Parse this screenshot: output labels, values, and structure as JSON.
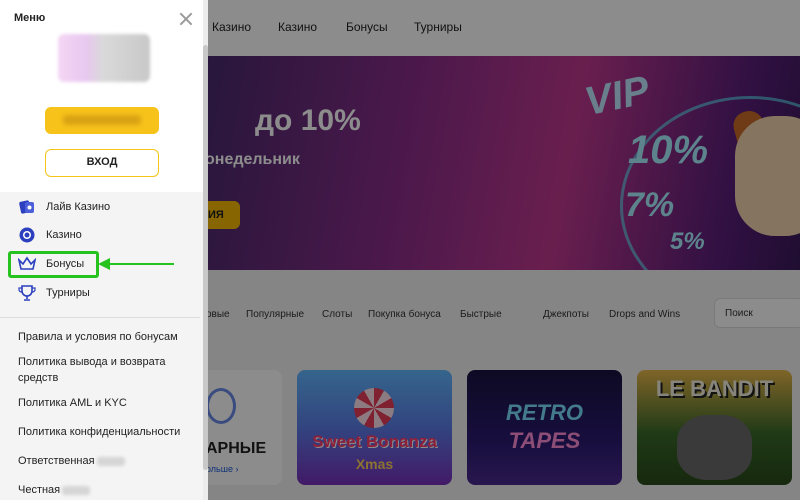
{
  "topnav": {
    "items": [
      "Казино",
      "Казино",
      "Бонусы",
      "Турниры"
    ]
  },
  "banner": {
    "title": "до 10%",
    "subtitle": "онедельник",
    "cta_label": "ИЯ",
    "vip": "VIP",
    "percents": [
      "10%",
      "7%",
      "5%"
    ]
  },
  "categories": [
    "овые",
    "Популярные",
    "Слоты",
    "Покупка бонуса",
    "Быстрые",
    "Джекпоты",
    "Drops and Wins"
  ],
  "search": {
    "label": "Поиск"
  },
  "promo_card": {
    "title": "АРНЫЕ",
    "more": "ольше ›"
  },
  "games": {
    "g1": {
      "title": "Sweet Bonanza",
      "sub": "Xmas"
    },
    "g2": {
      "title": "RETRO",
      "title2": "TAPES"
    },
    "g3": {
      "title": "LE BANDIT"
    }
  },
  "menu": {
    "title": "Меню",
    "login_label": "ВХОД",
    "items": [
      {
        "label": "Лайв Казино",
        "icon": "live-casino-icon"
      },
      {
        "label": "Казино",
        "icon": "chip-icon"
      },
      {
        "label": "Бонусы",
        "icon": "crown-icon"
      },
      {
        "label": "Турниры",
        "icon": "trophy-icon"
      }
    ],
    "links": [
      "Правила и условия по бонусам",
      "Политика вывода и возврата средств",
      "Политика AML и KYC",
      "Политика конфиденциальности",
      "Ответственная",
      "Честная"
    ]
  },
  "colors": {
    "accent": "#f7c21a",
    "highlight": "#26c21f",
    "icon": "#2b3fbf"
  }
}
